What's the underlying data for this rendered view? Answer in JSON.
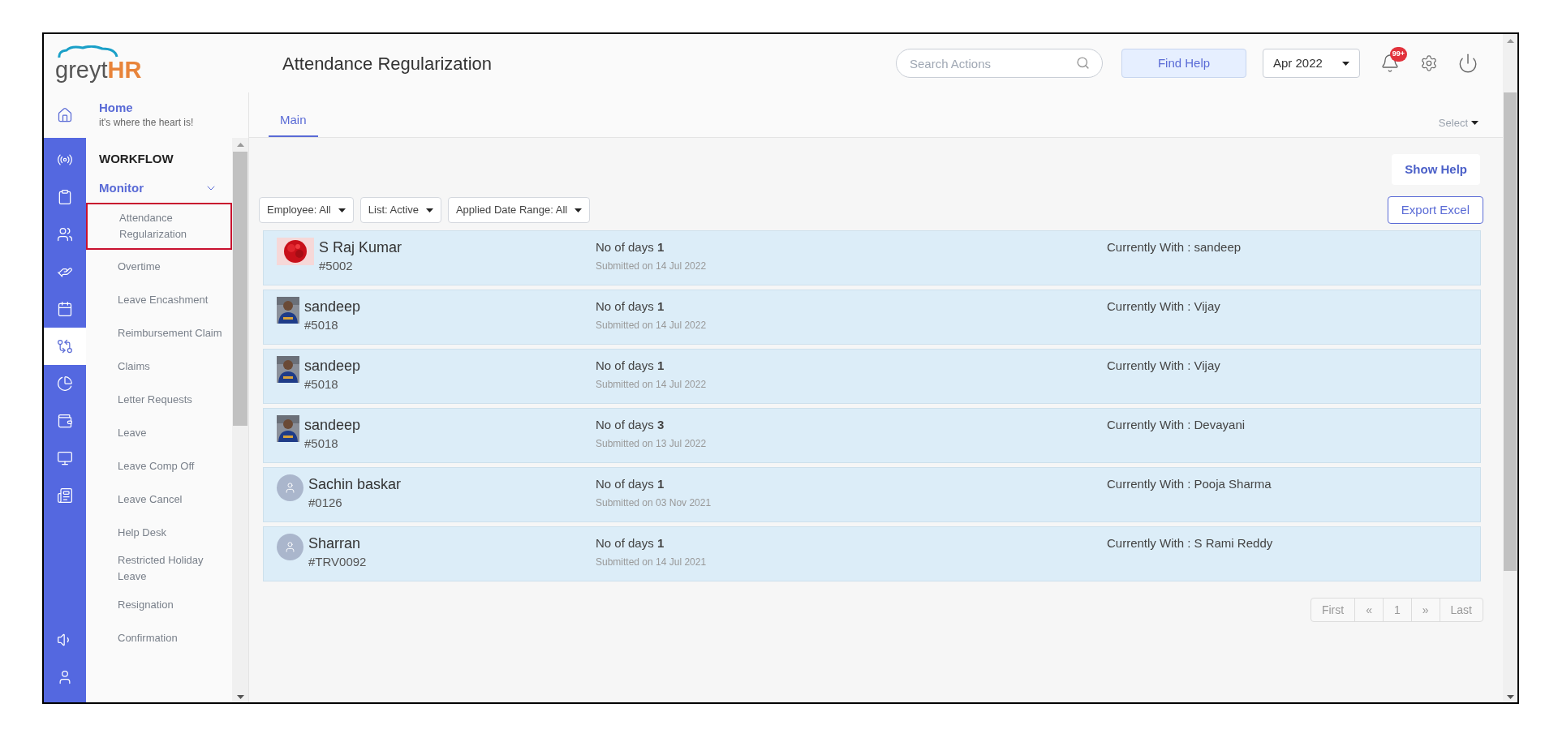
{
  "logo": {
    "part1": "greyt",
    "part2": "HR"
  },
  "header": {
    "title": "Attendance Regularization",
    "search": {
      "placeholder": "Search Actions"
    },
    "help_button": "Find Help",
    "period": "Apr 2022",
    "notification_badge": "99+"
  },
  "home": {
    "title": "Home",
    "subtitle": "it's where the heart is!"
  },
  "rail": [
    {
      "selected": false
    },
    {
      "selected": false
    },
    {
      "selected": false
    },
    {
      "selected": false
    },
    {
      "selected": false
    },
    {
      "selected": true
    },
    {
      "selected": false
    },
    {
      "selected": false
    },
    {
      "selected": false
    },
    {
      "selected": false
    }
  ],
  "rail_bottom": [
    {
      "selected": false
    },
    {
      "selected": false
    }
  ],
  "sidebar": {
    "section": "WORKFLOW",
    "group": {
      "label": "Monitor",
      "expanded": true
    },
    "items": [
      {
        "label": "Attendance Regularization",
        "selected": true
      },
      {
        "label": "Overtime",
        "selected": false
      },
      {
        "label": "Leave Encashment",
        "selected": false
      },
      {
        "label": "Reimbursement Claim",
        "selected": false
      },
      {
        "label": "Claims",
        "selected": false
      },
      {
        "label": "Letter Requests",
        "selected": false
      },
      {
        "label": "Leave",
        "selected": false
      },
      {
        "label": "Leave Comp Off",
        "selected": false
      },
      {
        "label": "Leave Cancel",
        "selected": false
      },
      {
        "label": "Help Desk",
        "selected": false
      },
      {
        "label": "Restricted Holiday Leave",
        "selected": false
      },
      {
        "label": "Resignation",
        "selected": false
      },
      {
        "label": "Confirmation",
        "selected": false
      }
    ]
  },
  "tabs": [
    {
      "label": "Main",
      "selected": true
    }
  ],
  "select_menu": "Select",
  "show_help": "Show Help",
  "filters": [
    {
      "label": "Employee: All"
    },
    {
      "label": "List: Active"
    },
    {
      "label": "Applied Date Range: All"
    }
  ],
  "export_button": "Export Excel",
  "requests": [
    {
      "avatar": {
        "kind": "flower"
      },
      "name": "S Raj Kumar",
      "id": "#5002",
      "days_label": "No of days",
      "days": "1",
      "submitted": "Submitted on 14 Jul 2022",
      "currently_with": "Currently With : sandeep"
    },
    {
      "avatar": {
        "kind": "person"
      },
      "name": "sandeep",
      "id": "#5018",
      "days_label": "No of days",
      "days": "1",
      "submitted": "Submitted on 14 Jul 2022",
      "currently_with": "Currently With : Vijay"
    },
    {
      "avatar": {
        "kind": "person"
      },
      "name": "sandeep",
      "id": "#5018",
      "days_label": "No of days",
      "days": "1",
      "submitted": "Submitted on 14 Jul 2022",
      "currently_with": "Currently With : Vijay"
    },
    {
      "avatar": {
        "kind": "person"
      },
      "name": "sandeep",
      "id": "#5018",
      "days_label": "No of days",
      "days": "3",
      "submitted": "Submitted on 13 Jul 2022",
      "currently_with": "Currently With : Devayani"
    },
    {
      "avatar": {
        "kind": "default"
      },
      "name": "Sachin baskar",
      "id": "#0126",
      "days_label": "No of days",
      "days": "1",
      "submitted": "Submitted on 03 Nov 2021",
      "currently_with": "Currently With : Pooja Sharma"
    },
    {
      "avatar": {
        "kind": "default"
      },
      "name": "Sharran",
      "id": "#TRV0092",
      "days_label": "No of days",
      "days": "1",
      "submitted": "Submitted on 14 Jul 2021",
      "currently_with": "Currently With : S Rami Reddy"
    }
  ],
  "pagination": [
    "First",
    "«",
    "1",
    "»",
    "Last"
  ]
}
